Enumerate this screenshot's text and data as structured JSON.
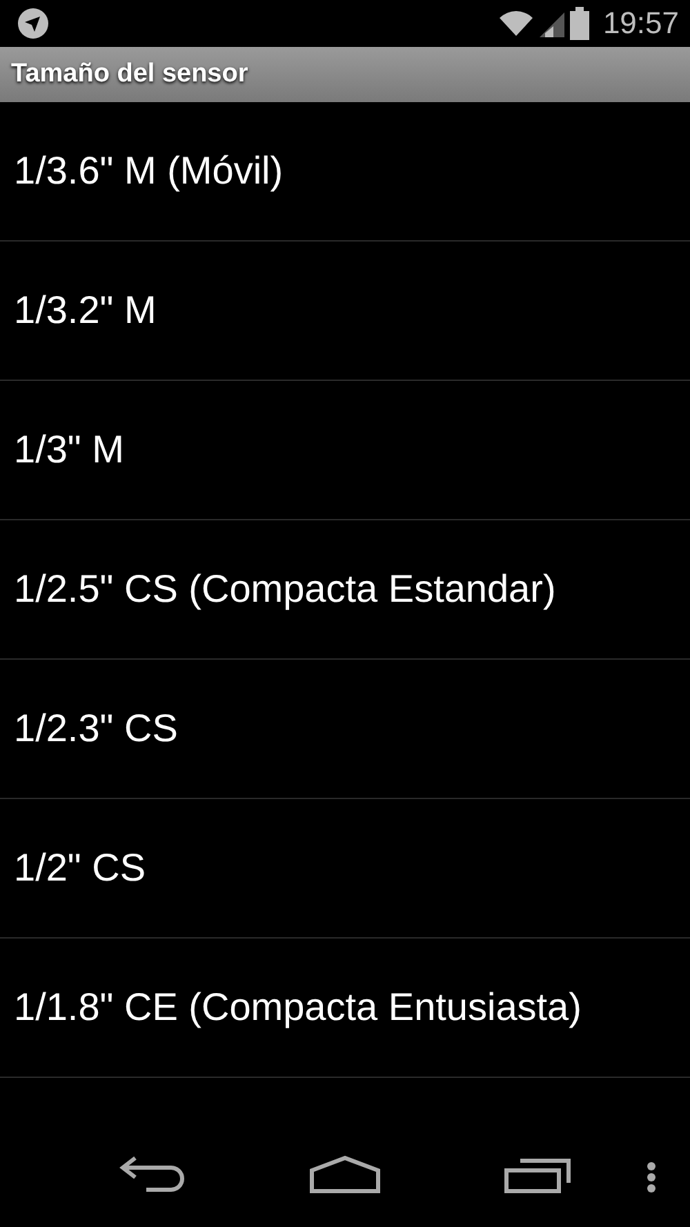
{
  "status_bar": {
    "time": "19:57"
  },
  "title": "Tamaño del sensor",
  "items": [
    {
      "label": "1/3.6\" M (Móvil)"
    },
    {
      "label": "1/3.2\" M"
    },
    {
      "label": "1/3\" M"
    },
    {
      "label": "1/2.5\" CS (Compacta Estandar)"
    },
    {
      "label": "1/2.3\" CS"
    },
    {
      "label": "1/2\" CS"
    },
    {
      "label": "1/1.8\" CE (Compacta Entusiasta)"
    }
  ]
}
